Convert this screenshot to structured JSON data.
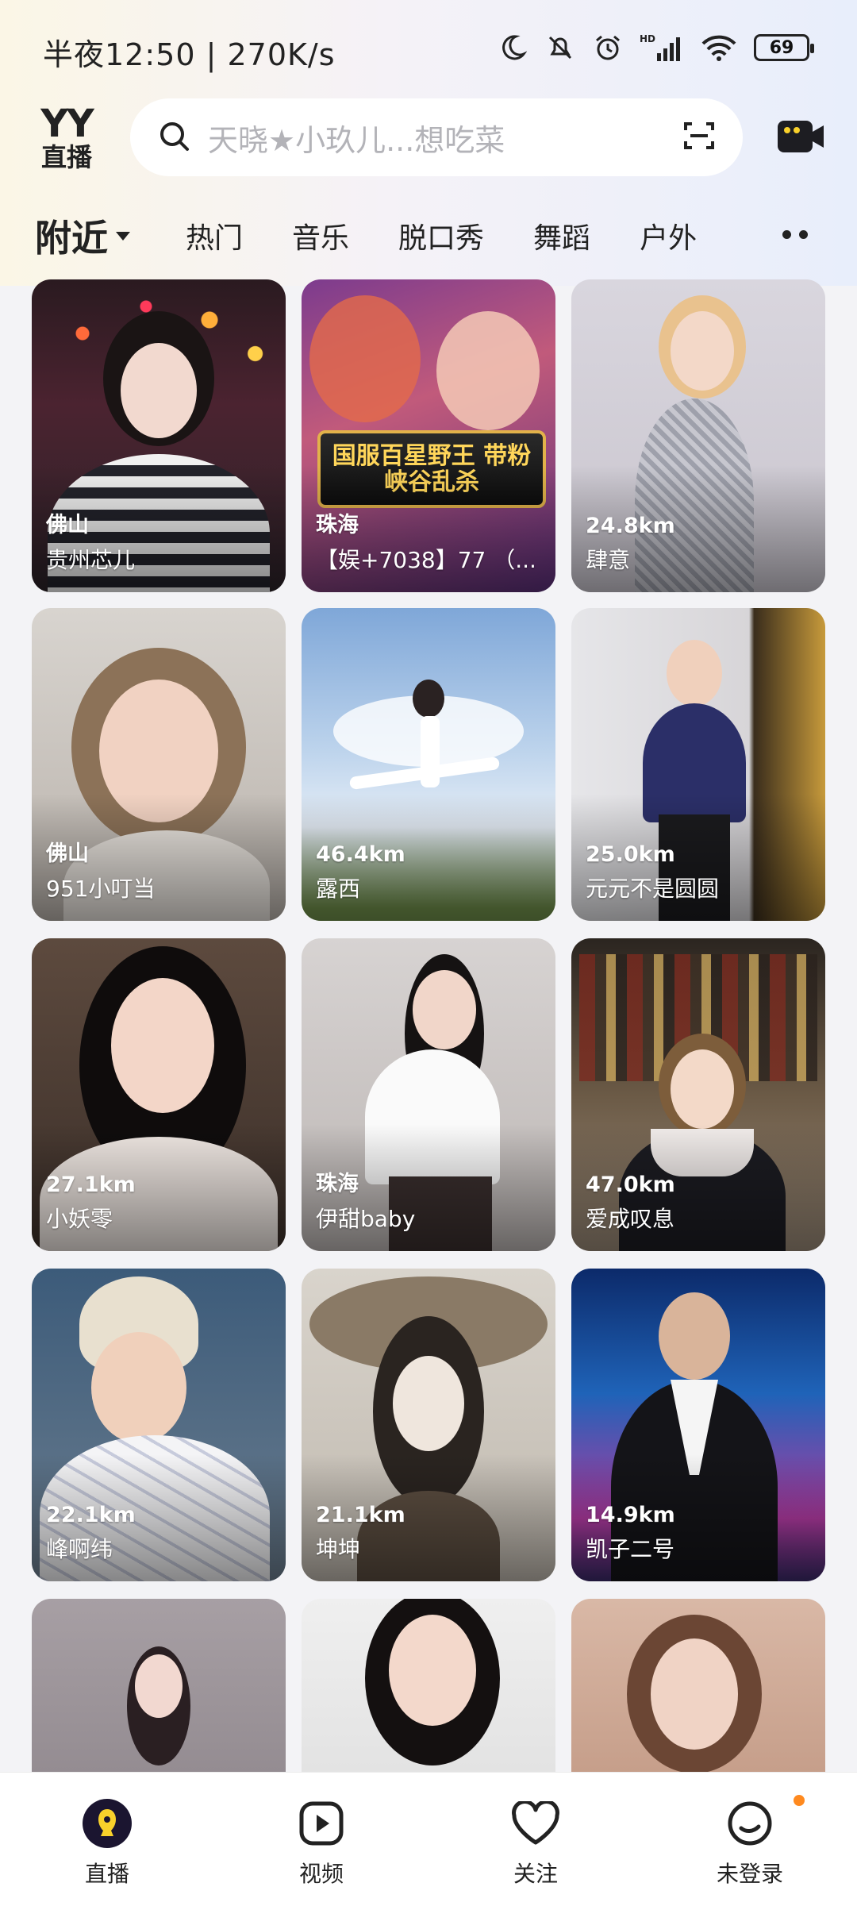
{
  "status_bar": {
    "time_speed": "半夜12:50 | 270K/s",
    "battery": "69"
  },
  "header": {
    "logo_top": "YY",
    "logo_bottom": "直播",
    "search_placeholder": "天晓★小玖儿...想吃菜"
  },
  "tabs": [
    {
      "label": "附近",
      "active": true
    },
    {
      "label": "热门"
    },
    {
      "label": "音乐"
    },
    {
      "label": "脱口秀"
    },
    {
      "label": "舞蹈"
    },
    {
      "label": "户外"
    }
  ],
  "cards": [
    {
      "distance": "佛山",
      "name": "贵州芯儿"
    },
    {
      "distance": "珠海",
      "name": "【娱+7038】77 （..."
    },
    {
      "distance": "24.8km",
      "name": "肆意"
    },
    {
      "distance": "佛山",
      "name": "951小叮当"
    },
    {
      "distance": "46.4km",
      "name": "露西"
    },
    {
      "distance": "25.0km",
      "name": "元元不是圆圆"
    },
    {
      "distance": "27.1km",
      "name": "小妖零"
    },
    {
      "distance": "珠海",
      "name": "伊甜baby"
    },
    {
      "distance": "47.0km",
      "name": "爱成叹息"
    },
    {
      "distance": "22.1km",
      "name": "峰啊纬"
    },
    {
      "distance": "21.1km",
      "name": "坤坤"
    },
    {
      "distance": "14.9km",
      "name": "凯子二号"
    },
    {
      "distance": "",
      "name": ""
    },
    {
      "distance": "",
      "name": ""
    },
    {
      "distance": "",
      "name": ""
    }
  ],
  "card_banner": "国服百星野王 带粉峡谷乱杀",
  "bottom_nav": [
    {
      "label": "直播",
      "icon": "live-icon"
    },
    {
      "label": "视频",
      "icon": "video-icon"
    },
    {
      "label": "关注",
      "icon": "heart-icon"
    },
    {
      "label": "未登录",
      "icon": "profile-icon"
    }
  ],
  "colors": {
    "accent": "#f9d12b",
    "notify_dot": "#ff8a1f"
  }
}
